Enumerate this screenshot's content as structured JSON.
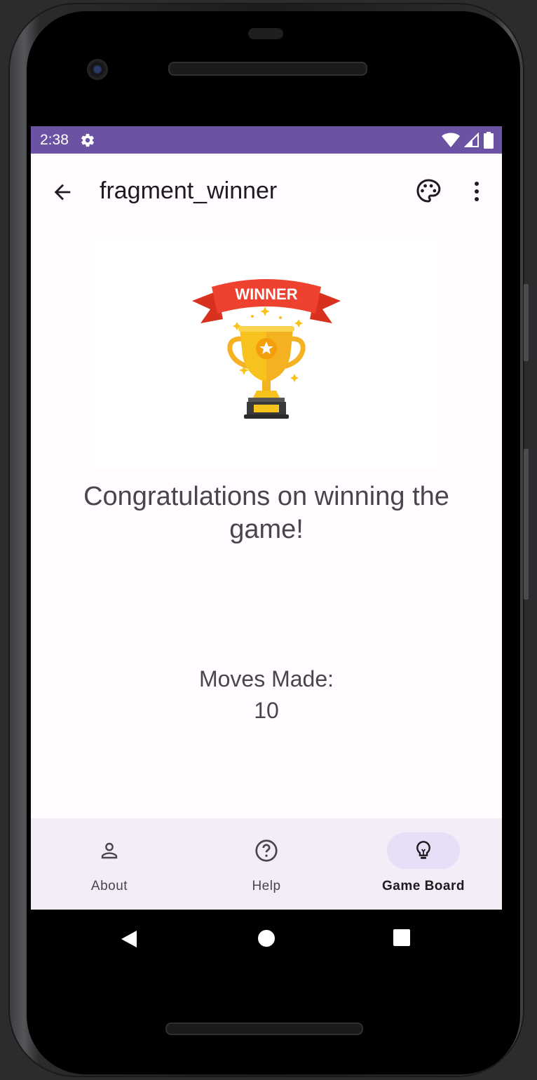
{
  "status_bar": {
    "time": "2:38",
    "icons": [
      "settings-gear-icon",
      "wifi-icon",
      "cell-signal-icon",
      "battery-icon"
    ],
    "color": "#6b52a3"
  },
  "app_bar": {
    "title": "fragment_winner",
    "actions": [
      "back-arrow-icon",
      "palette-icon",
      "more-vert-icon"
    ]
  },
  "winner_image": {
    "banner_text": "WINNER"
  },
  "main": {
    "congrats_message": "Congratulations on winning the game!",
    "moves_label": "Moves Made:",
    "moves_value": "10"
  },
  "bottom_nav": {
    "items": [
      {
        "label": "About",
        "icon": "person-icon",
        "active": false
      },
      {
        "label": "Help",
        "icon": "help-circle-icon",
        "active": false
      },
      {
        "label": "Game Board",
        "icon": "lightbulb-icon",
        "active": true
      }
    ],
    "background": "#f3edf7",
    "active_indicator": "#e8def8"
  },
  "system_nav": {
    "buttons": [
      "back-triangle-icon",
      "home-circle-icon",
      "recents-square-icon"
    ]
  }
}
